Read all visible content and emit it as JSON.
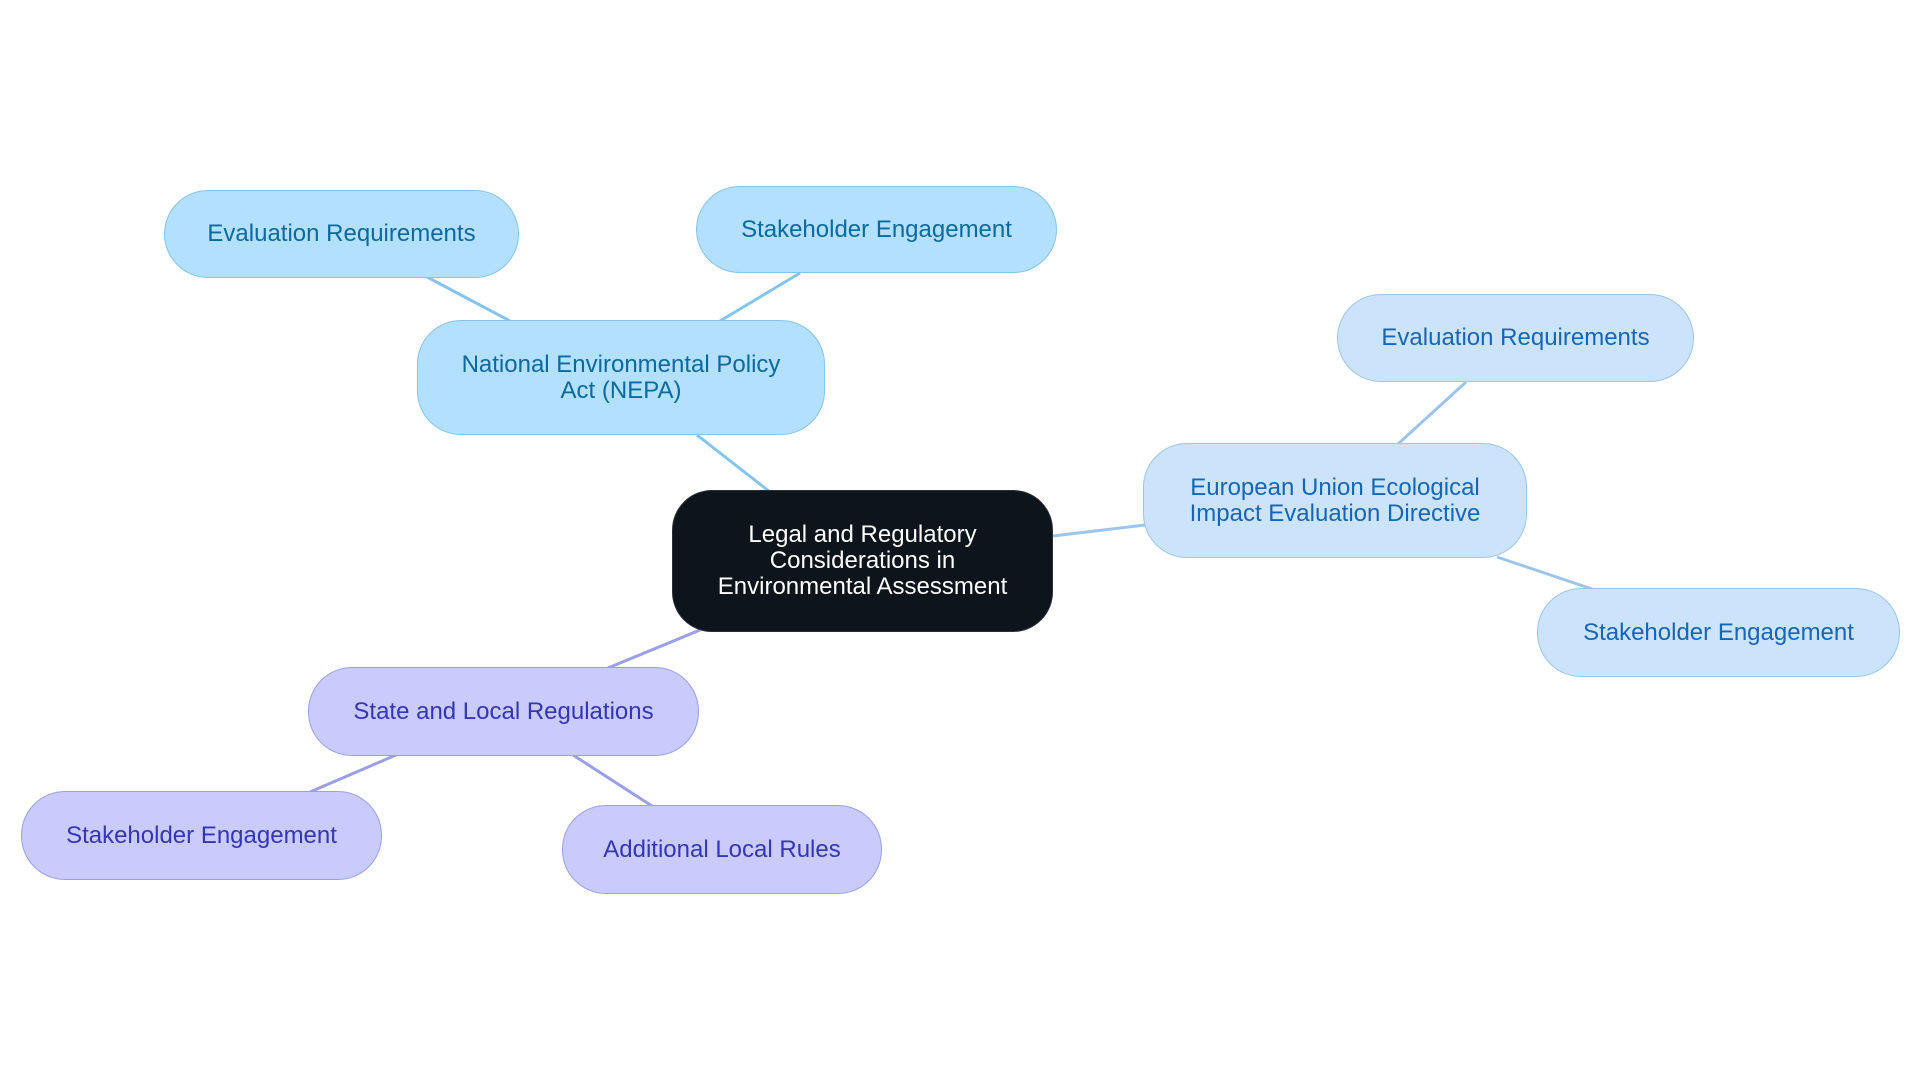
{
  "diagram": {
    "type": "mind-map",
    "root": {
      "label": "Legal and Regulatory Considerations in Environmental Assessment"
    },
    "branches": [
      {
        "label": "National Environmental Policy Act (NEPA)",
        "color": "#b3e0fe",
        "children": [
          {
            "label": "Evaluation Requirements"
          },
          {
            "label": "Stakeholder Engagement"
          }
        ]
      },
      {
        "label": "European Union Ecological Impact Evaluation Directive",
        "color": "#cce4fb",
        "children": [
          {
            "label": "Evaluation Requirements"
          },
          {
            "label": "Stakeholder Engagement"
          }
        ]
      },
      {
        "label": "State and Local Regulations",
        "color": "#c8cbfc",
        "children": [
          {
            "label": "Stakeholder Engagement"
          },
          {
            "label": "Additional Local Rules"
          }
        ]
      }
    ],
    "edge_colors": {
      "nepa": "#84c4ee",
      "eu": "#9cc4ec",
      "state": "#9b9fe8"
    }
  }
}
